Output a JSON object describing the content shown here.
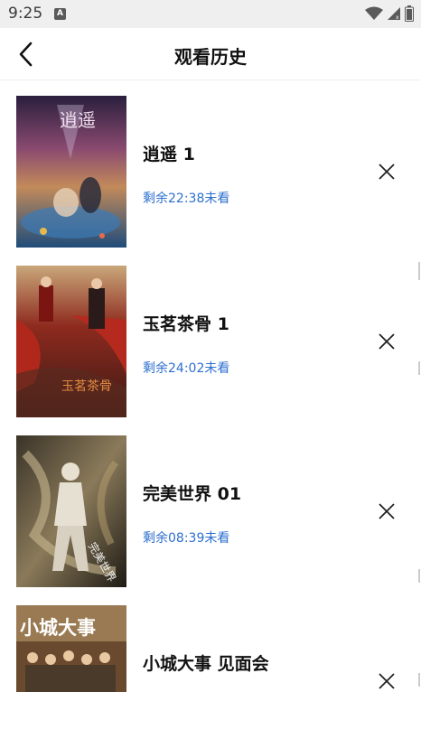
{
  "status_bar": {
    "time": "9:25",
    "icons": [
      "a-icon",
      "wifi-icon",
      "signal-icon",
      "battery-icon"
    ]
  },
  "header": {
    "title": "观看历史",
    "back_icon": "chevron-left-icon"
  },
  "history": {
    "items": [
      {
        "title": "逍遥 1",
        "remaining": "剩余22:38未看",
        "poster_text": "逍遥"
      },
      {
        "title": "玉茗茶骨 1",
        "remaining": "剩余24:02未看",
        "poster_text": "玉茗茶骨"
      },
      {
        "title": "完美世界 01",
        "remaining": "剩余08:39未看",
        "poster_text": "完美世界"
      },
      {
        "title": "小城大事 见面会",
        "remaining": "",
        "poster_text": "小城大事"
      }
    ],
    "delete_icon": "close-icon"
  },
  "colors": {
    "remaining_text": "#2d6fcf",
    "title_text": "#111111",
    "status_bar_bg": "#efefef"
  }
}
